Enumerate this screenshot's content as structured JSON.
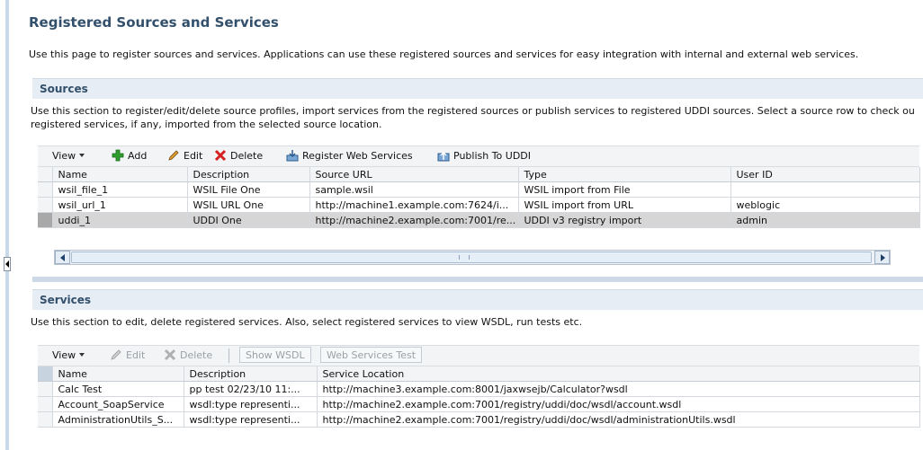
{
  "page": {
    "title": "Registered Sources and Services",
    "description": "Use this page to register sources and services. Applications can use these registered sources and services for easy integration with internal and external web services."
  },
  "sources": {
    "title": "Sources",
    "description_line1": "Use this section to register/edit/delete source profiles, import services from the registered sources or publish services to registered UDDI sources. Select a source row to check ou",
    "description_line2": "registered services, if any, imported from the selected source location.",
    "toolbar": {
      "view": "View",
      "add": "Add",
      "edit": "Edit",
      "delete": "Delete",
      "register": "Register Web Services",
      "publish": "Publish To UDDI"
    },
    "columns": [
      "Name",
      "Description",
      "Source URL",
      "Type",
      "User ID"
    ],
    "rows": [
      [
        "wsil_file_1",
        "WSIL File One",
        "sample.wsil",
        "WSIL import from File",
        ""
      ],
      [
        "wsil_url_1",
        "WSIL URL One",
        "http://machine1.example.com:7624/i...",
        "WSIL import from URL",
        "weblogic"
      ],
      [
        "uddi_1",
        "UDDI One",
        "http://machine2.example.com:7001/re...",
        "UDDI v3 registry import",
        "admin"
      ]
    ]
  },
  "services": {
    "title": "Services",
    "description": "Use this section to edit, delete registered services. Also, select registered services to view WSDL, run tests etc.",
    "toolbar": {
      "view": "View",
      "edit": "Edit",
      "delete": "Delete",
      "show_wsdl": "Show WSDL",
      "ws_test": "Web Services Test"
    },
    "columns": [
      "Name",
      "Description",
      "Service Location"
    ],
    "rows": [
      [
        "Calc Test",
        "pp test 02/23/10 11:...",
        "http://machine3.example.com:8001/jaxwsejb/Calculator?wsdl"
      ],
      [
        "Account_SoapService",
        "wsdl:type representi...",
        "http://machine2.example.com:7001/registry/uddi/doc/wsdl/account.wsdl"
      ],
      [
        "AdministrationUtils_S...",
        "wsdl:type representi...",
        "http://machine2.example.com:7001/registry/uddi/doc/wsdl/administrationUtils.wsdl"
      ]
    ]
  },
  "colors": {
    "title": "#324f6b",
    "header_bg": "#e6edf4",
    "add_icon": "#2e9e2e",
    "delete_icon": "#d42020"
  }
}
